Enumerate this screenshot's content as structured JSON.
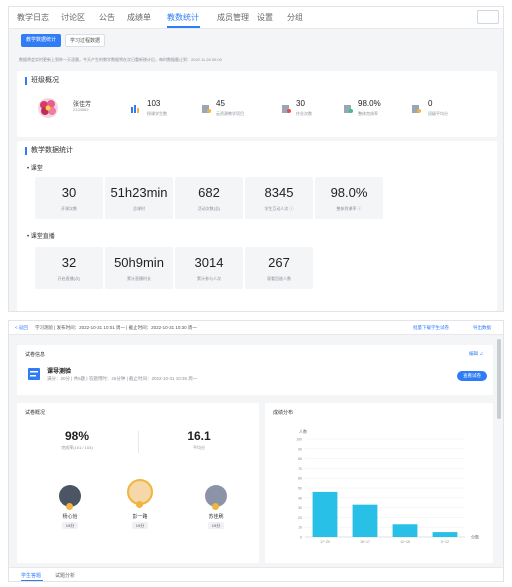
{
  "panel1": {
    "nav": [
      "教学日志",
      "讨论区",
      "公告",
      "成绩单",
      "教数统计",
      "成员管理",
      "设置",
      "分组"
    ],
    "active_nav_index": 4,
    "tabs": [
      "教学数据统计",
      "学习过程数据"
    ],
    "notice": "数据将会实时更新上到昨一天凌晨，今天产生的教学数据将在次日重新统计后，每时数据截止到：2022.11.26 00:00",
    "class_overview_title": "班级概况",
    "teacher": {
      "name": "张佳芳",
      "id": "2124062"
    },
    "stats": [
      {
        "icon": "students-icon",
        "value": "103",
        "label": "授课学生数"
      },
      {
        "icon": "resource-icon",
        "value": "45",
        "label": "云资源教学项目"
      },
      {
        "icon": "test-icon",
        "value": "30",
        "label": "作业次数"
      },
      {
        "icon": "rate-icon",
        "value": "98.0%",
        "label": "整体完成率"
      },
      {
        "icon": "score-icon",
        "value": "0",
        "label": "班级平均分"
      }
    ],
    "teaching_stats_title": "教学数据统计",
    "classroom_title": "课堂",
    "classroom_metrics": [
      {
        "value": "30",
        "label": "开课次数"
      },
      {
        "value": "51h23min",
        "label": "总课时"
      },
      {
        "value": "682",
        "label": "活动次数(总)"
      },
      {
        "value": "8345",
        "label": "学生互动人次 ⓘ"
      },
      {
        "value": "98.0%",
        "label": "整体到课率 ⓘ"
      }
    ],
    "live_title": "课堂直播",
    "live_metrics": [
      {
        "value": "32",
        "label": "开启直播(次)"
      },
      {
        "value": "50h9min",
        "label": "累计直播时长"
      },
      {
        "value": "3014",
        "label": "累计参与人次"
      },
      {
        "value": "267",
        "label": "观看回放人数"
      }
    ]
  },
  "panel2": {
    "topbar": {
      "back": "< 返回",
      "crumb": "学习测验 | 发布时间：2022-10-31 10:01 周一 | 截止时间：2022-10-31 10:30 周一",
      "action1": "批量下载学生试卷",
      "action2": "导出数据"
    },
    "paper_section_title": "试卷信息",
    "edit_label": "编辑 ∠",
    "paper_name": "课导测验",
    "paper_meta": "满分：20分 | 共5题 | 答题用时：25分钟 | 截止时间：2022-10-31 10:35 周一",
    "view_paper_button": "查看试卷",
    "overview_title": "试卷概况",
    "completion_rate": "98%",
    "completion_detail": "完成率(101 / 103)",
    "average_score": "16.1",
    "average_label": "平均分",
    "top_students": [
      {
        "name": "杨心怡",
        "score": "19分"
      },
      {
        "name": "彭一路",
        "score": "19分"
      },
      {
        "name": "苏佳刷",
        "score": "19分"
      }
    ],
    "distribution_title": "成绩分布",
    "bottom_tabs": [
      "学生答题",
      "试题分析"
    ]
  },
  "chart_data": {
    "type": "bar",
    "title": "成绩分布",
    "ylabel": "人数",
    "xlabel": "分数",
    "ylim": [
      0,
      100
    ],
    "yticks": [
      0,
      10,
      20,
      30,
      40,
      50,
      60,
      70,
      80,
      90,
      100
    ],
    "categories": [
      "17~20",
      "15~17",
      "12~15",
      "0~12"
    ],
    "values": [
      46,
      33,
      13,
      5
    ],
    "color": "#29c0e8"
  }
}
